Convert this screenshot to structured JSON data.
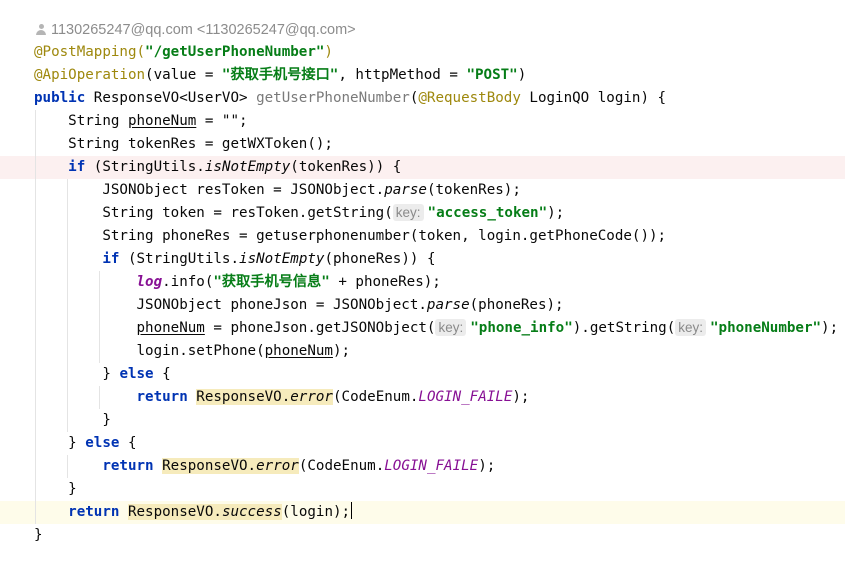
{
  "author": {
    "icon": "person-icon",
    "text": "1130265247@qq.com <1130265247@qq.com>"
  },
  "code": {
    "l1": {
      "ann": "@PostMapping(",
      "str": "\"/getUserPhoneNumber\"",
      "close": ")"
    },
    "l2": {
      "ann": "@ApiOperation",
      "p1": "(value = ",
      "s1": "\"获取手机号接口\"",
      "p2": ", httpMethod = ",
      "s2": "\"POST\"",
      "p3": ")"
    },
    "l3": {
      "kw": "public",
      "type": " ResponseVO<UserVO> ",
      "name": "getUserPhoneNumber",
      "p1": "(",
      "ann": "@RequestBody",
      "p2": " LoginQO login) {"
    },
    "l4": {
      "t1": "String ",
      "var": "phoneNum",
      "t2": " = \"\";"
    },
    "l5": {
      "t1": "String tokenRes = getWXToken();"
    },
    "l6": {
      "kw": "if",
      "t1": " (StringUtils.",
      "m": "isNotEmpty",
      "t2": "(tokenRes)) {"
    },
    "l7": {
      "t1": "JSONObject resToken = JSONObject.",
      "m": "parse",
      "t2": "(tokenRes);"
    },
    "l8": {
      "t1": "String token = resToken.getString(",
      "hint": "key:",
      "str": "\"access_token\"",
      "t2": ");"
    },
    "l9": {
      "t1": "String phoneRes = getuserphonenumber(token, login.getPhoneCode());"
    },
    "l10": {
      "kw": "if",
      "t1": " (StringUtils.",
      "m": "isNotEmpty",
      "t2": "(phoneRes)) {"
    },
    "l11": {
      "field": "log",
      "t1": ".info(",
      "str": "\"获取手机号信息\"",
      "t2": " + phoneRes);"
    },
    "l12": {
      "t1": "JSONObject phoneJson = JSONObject.",
      "m": "parse",
      "t2": "(phoneRes);"
    },
    "l13": {
      "var": "phoneNum",
      "t1": " = phoneJson.getJSONObject(",
      "hint1": "key:",
      "s1": "\"phone_info\"",
      "t2": ").getString(",
      "hint2": "key:",
      "s2": "\"phoneNumber\"",
      "t3": ");"
    },
    "l14": {
      "t1": "login.setPhone(",
      "var": "phoneNum",
      "t2": ");"
    },
    "l15": {
      "t1": "} ",
      "kw": "else",
      "t2": " {"
    },
    "l16": {
      "kw": "return",
      "sp": " ",
      "cls": "ResponseVO.",
      "m": "error",
      "t1": "(CodeEnum.",
      "const": "LOGIN_FAILE",
      "t2": ");"
    },
    "l17": {
      "t1": "}"
    },
    "l18": {
      "t1": "} ",
      "kw": "else",
      "t2": " {"
    },
    "l19": {
      "kw": "return",
      "sp": " ",
      "cls": "ResponseVO.",
      "m": "error",
      "t1": "(CodeEnum.",
      "const": "LOGIN_FAILE",
      "t2": ");"
    },
    "l20": {
      "t1": "}"
    },
    "l21": {
      "kw": "return",
      "sp": " ",
      "cls": "ResponseVO.",
      "m": "success",
      "t1": "(login);"
    },
    "l22": {
      "t1": "}"
    }
  }
}
